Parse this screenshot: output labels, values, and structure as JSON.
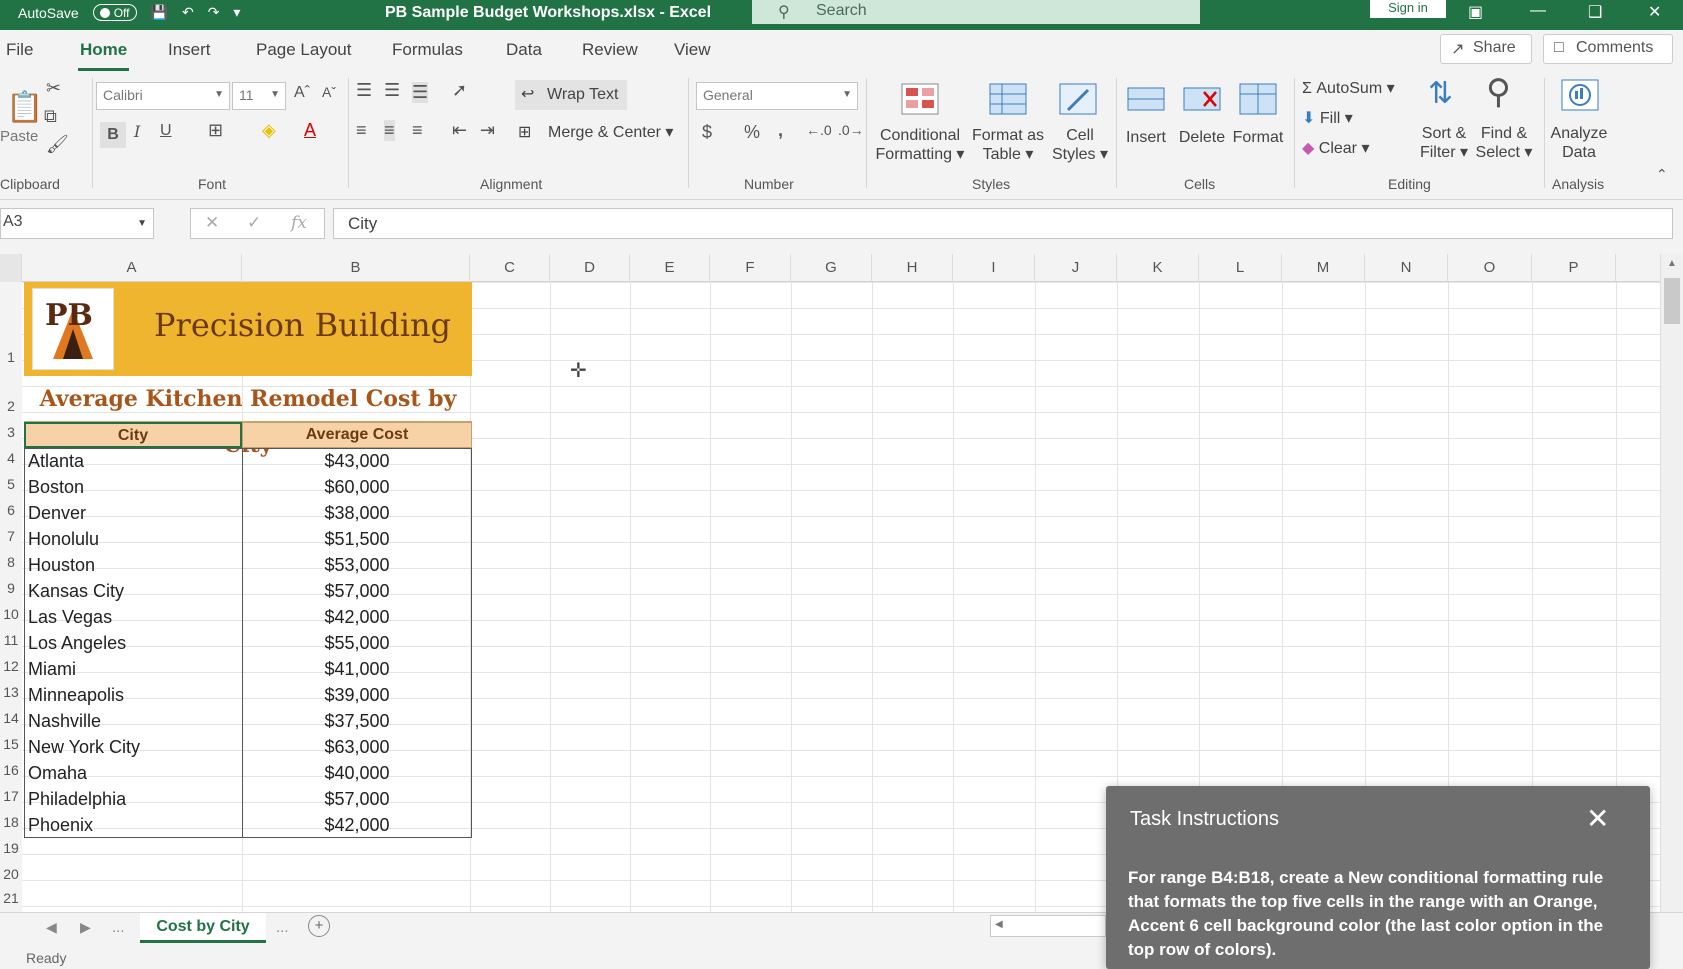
{
  "titlebar": {
    "autosave_label": "AutoSave",
    "autosave_state": "Off",
    "document_title": "PB Sample Budget Workshops.xlsx - Excel",
    "search_placeholder": "Search",
    "signin_label": "Sign in"
  },
  "ribbon_tabs": {
    "items": [
      "File",
      "Home",
      "Insert",
      "Page Layout",
      "Formulas",
      "Data",
      "Review",
      "View"
    ],
    "active": "Home",
    "share_label": "Share",
    "comments_label": "Comments"
  },
  "ribbon": {
    "clipboard": {
      "paste_label": "Paste",
      "group_label": "Clipboard"
    },
    "font": {
      "font_name": "Calibri",
      "font_size": "11",
      "group_label": "Font",
      "bold": "B",
      "italic": "I",
      "underline": "U"
    },
    "alignment": {
      "wrap_text": "Wrap Text",
      "merge_center": "Merge & Center",
      "group_label": "Alignment"
    },
    "number": {
      "format": "General",
      "currency": "$",
      "percent": "%",
      "comma": ",",
      "group_label": "Number"
    },
    "styles": {
      "conditional": [
        "Conditional",
        "Formatting"
      ],
      "format_table": [
        "Format as",
        "Table"
      ],
      "cell_styles": [
        "Cell",
        "Styles"
      ],
      "group_label": "Styles"
    },
    "cells": {
      "insert": "Insert",
      "delete": "Delete",
      "format": "Format",
      "group_label": "Cells"
    },
    "editing": {
      "autosum": "AutoSum",
      "fill": "Fill",
      "clear": "Clear",
      "sort_filter": [
        "Sort &",
        "Filter"
      ],
      "find_select": [
        "Find &",
        "Select"
      ],
      "group_label": "Editing"
    },
    "analysis": {
      "analyze": [
        "Analyze",
        "Data"
      ],
      "group_label": "Analysis"
    }
  },
  "formula_bar": {
    "name_box": "A3",
    "fx": "fx",
    "value": "City"
  },
  "columns": [
    "A",
    "B",
    "C",
    "D",
    "E",
    "F",
    "G",
    "H",
    "I",
    "J",
    "K",
    "L",
    "M",
    "N",
    "O",
    "P"
  ],
  "sheet": {
    "banner_title": "Precision Building",
    "logo_text": "PB",
    "subtitle": "Average Kitchen Remodel Cost by City",
    "header_city": "City",
    "header_cost": "Average Cost",
    "rows": [
      {
        "city": "Atlanta",
        "cost": "$43,000"
      },
      {
        "city": "Boston",
        "cost": "$60,000"
      },
      {
        "city": "Denver",
        "cost": "$38,000"
      },
      {
        "city": "Honolulu",
        "cost": "$51,500"
      },
      {
        "city": "Houston",
        "cost": "$53,000"
      },
      {
        "city": "Kansas City",
        "cost": "$57,000"
      },
      {
        "city": "Las Vegas",
        "cost": "$42,000"
      },
      {
        "city": "Los Angeles",
        "cost": "$55,000"
      },
      {
        "city": "Miami",
        "cost": "$41,000"
      },
      {
        "city": "Minneapolis",
        "cost": "$39,000"
      },
      {
        "city": "Nashville",
        "cost": "$37,500"
      },
      {
        "city": "New York City",
        "cost": "$63,000"
      },
      {
        "city": "Omaha",
        "cost": "$40,000"
      },
      {
        "city": "Philadelphia",
        "cost": "$57,000"
      },
      {
        "city": "Phoenix",
        "cost": "$42,000"
      }
    ],
    "row_numbers": [
      "1",
      "2",
      "3",
      "4",
      "5",
      "6",
      "7",
      "8",
      "9",
      "10",
      "11",
      "12",
      "13",
      "14",
      "15",
      "16",
      "17",
      "18",
      "19",
      "20",
      "21"
    ]
  },
  "sheet_tabs": {
    "active": "Cost by City",
    "more": "..."
  },
  "status": {
    "text": "Ready"
  },
  "task_panel": {
    "title": "Task Instructions",
    "body": "For range B4:B18, create a New conditional formatting rule that formats the top five cells in the range with an Orange, Accent 6 cell background color (the last color option in the top row of colors)."
  },
  "colors": {
    "accent": "#217346",
    "banner": "#f0b52e",
    "header_fill": "#f7d2a6"
  }
}
